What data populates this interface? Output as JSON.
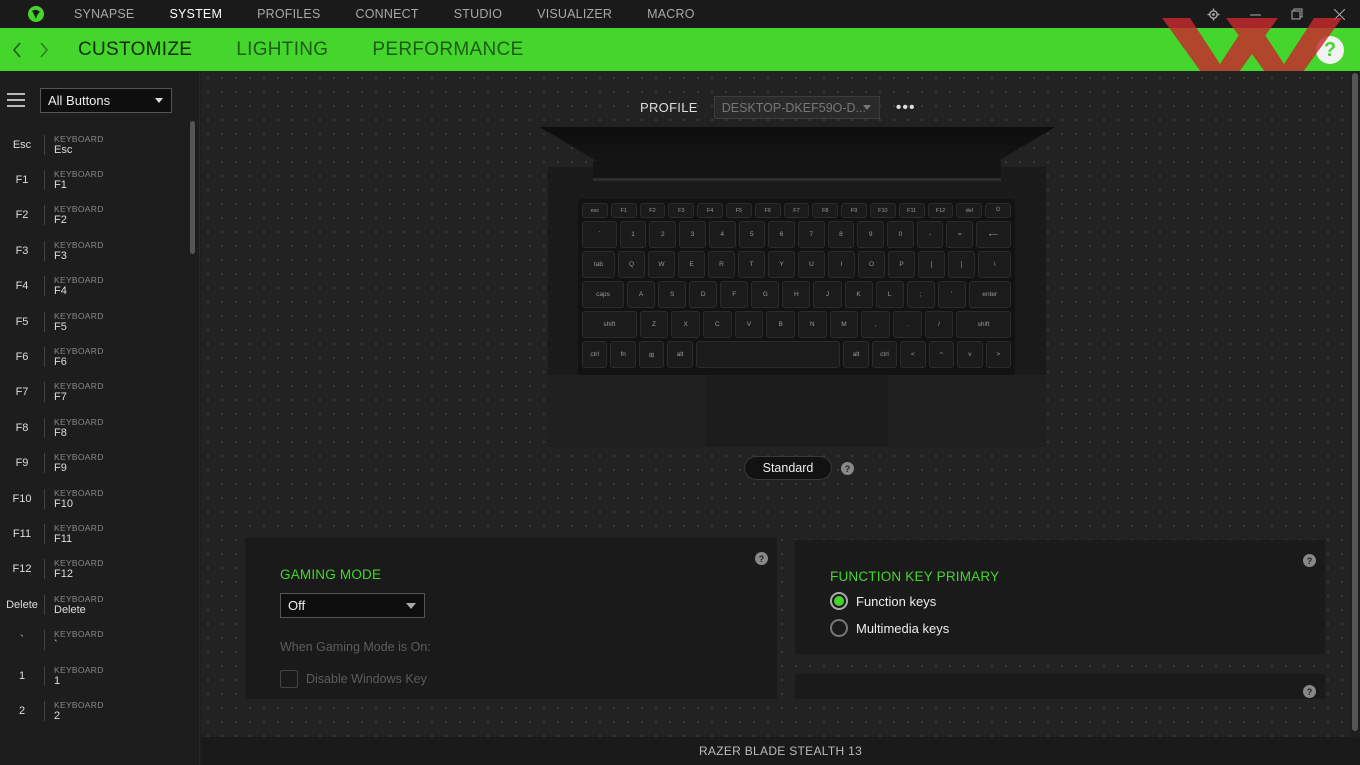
{
  "topnav": {
    "items": [
      "SYNAPSE",
      "SYSTEM",
      "PROFILES",
      "CONNECT",
      "STUDIO",
      "VISUALIZER",
      "MACRO"
    ],
    "active": "SYSTEM"
  },
  "tabs": {
    "items": [
      "CUSTOMIZE",
      "LIGHTING",
      "PERFORMANCE"
    ],
    "active": "CUSTOMIZE",
    "help": "?"
  },
  "sidebar": {
    "filter": "All Buttons",
    "keys": [
      {
        "name": "Esc",
        "category": "KEYBOARD",
        "value": "Esc"
      },
      {
        "name": "F1",
        "category": "KEYBOARD",
        "value": "F1"
      },
      {
        "name": "F2",
        "category": "KEYBOARD",
        "value": "F2"
      },
      {
        "name": "F3",
        "category": "KEYBOARD",
        "value": "F3"
      },
      {
        "name": "F4",
        "category": "KEYBOARD",
        "value": "F4"
      },
      {
        "name": "F5",
        "category": "KEYBOARD",
        "value": "F5"
      },
      {
        "name": "F6",
        "category": "KEYBOARD",
        "value": "F6"
      },
      {
        "name": "F7",
        "category": "KEYBOARD",
        "value": "F7"
      },
      {
        "name": "F8",
        "category": "KEYBOARD",
        "value": "F8"
      },
      {
        "name": "F9",
        "category": "KEYBOARD",
        "value": "F9"
      },
      {
        "name": "F10",
        "category": "KEYBOARD",
        "value": "F10"
      },
      {
        "name": "F11",
        "category": "KEYBOARD",
        "value": "F11"
      },
      {
        "name": "F12",
        "category": "KEYBOARD",
        "value": "F12"
      },
      {
        "name": "Delete",
        "category": "KEYBOARD",
        "value": "Delete"
      },
      {
        "name": "`",
        "category": "KEYBOARD",
        "value": "`"
      },
      {
        "name": "1",
        "category": "KEYBOARD",
        "value": "1"
      },
      {
        "name": "2",
        "category": "KEYBOARD",
        "value": "2"
      }
    ]
  },
  "profile": {
    "label": "PROFILE",
    "value": "DESKTOP-DKEF59O-D...",
    "more": "•••"
  },
  "keyboard": {
    "rows": [
      [
        "esc",
        "F1",
        "F2",
        "F3",
        "F4",
        "F5",
        "F6",
        "F7",
        "F8",
        "F9",
        "F10",
        "F11",
        "F12",
        "del",
        "⏻"
      ],
      [
        "`",
        "1",
        "2",
        "3",
        "4",
        "5",
        "6",
        "7",
        "8",
        "9",
        "0",
        "-",
        "=",
        "⟵"
      ],
      [
        "tab",
        "Q",
        "W",
        "E",
        "R",
        "T",
        "Y",
        "U",
        "I",
        "O",
        "P",
        "[",
        "]",
        "\\"
      ],
      [
        "caps",
        "A",
        "S",
        "D",
        "F",
        "G",
        "H",
        "J",
        "K",
        "L",
        ";",
        "'",
        "enter"
      ],
      [
        "shift",
        "Z",
        "X",
        "C",
        "V",
        "B",
        "N",
        "M",
        ",",
        ".",
        "/",
        "shift"
      ],
      [
        "ctrl",
        "fn",
        "⊞",
        "alt",
        "",
        "alt",
        "ctrl",
        "<",
        "^",
        "v",
        ">"
      ]
    ]
  },
  "mode": {
    "label": "Standard",
    "help": "?"
  },
  "gaming_mode": {
    "title": "GAMING MODE",
    "value": "Off",
    "when_label": "When Gaming Mode is On:",
    "option1": "Disable Windows Key",
    "help": "?"
  },
  "function_key": {
    "title": "FUNCTION KEY PRIMARY",
    "options": [
      "Function keys",
      "Multimedia keys"
    ],
    "selected": "Function keys",
    "help": "?"
  },
  "panel2": {
    "help": "?"
  },
  "statusbar": {
    "device": "RAZER BLADE STEALTH 13"
  },
  "colors": {
    "accent": "#44d62c",
    "background": "#222222",
    "watermark": "#c8282d"
  }
}
